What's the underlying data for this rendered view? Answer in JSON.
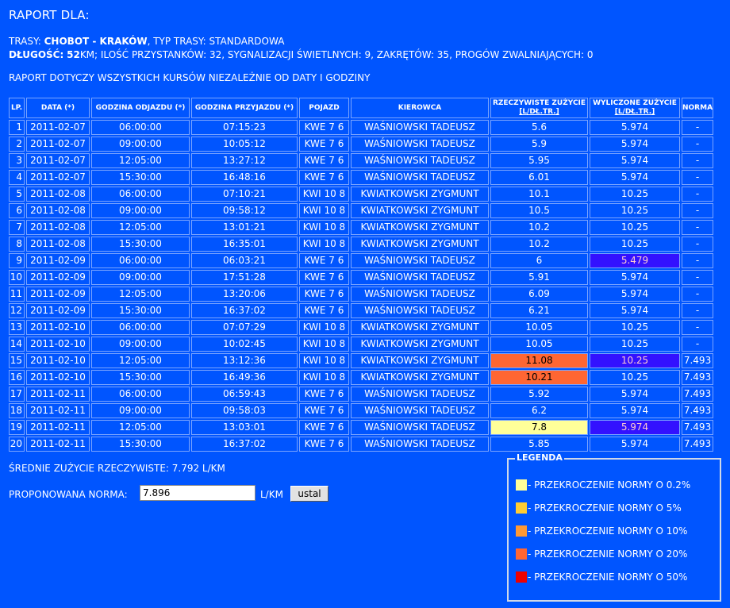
{
  "header": {
    "title": "RAPORT DLA:",
    "route_prefix": "TRASY:",
    "route_name": "CHOBOT - KRAKÓW",
    "route_type_text": ", TYP TRASY: STANDARDOWA",
    "length_label": "DŁUGOŚĆ:",
    "length_value": "52",
    "length_rest": "KM; ILOŚĆ PRZYSTANKÓW: 32, SYGNALIZACJI ŚWIETLNYCH: 9, ZAKRĘTÓW: 35, PROGÓW ZWALNIAJĄCYCH: 0",
    "scope_note": "RAPORT DOTYCZY WSZYSTKICH KURSÓW NIEZALEŻNIE OD DATY I GODZINY"
  },
  "table": {
    "columns": [
      "LP.",
      "DATA (*)",
      "GODZINA ODJAZDU (*)",
      "GODZINA PRZYJAZDU (*)",
      "POJAZD",
      "KIEROWCA",
      "RZECZYWISTE ZUŻYCIE",
      "WYLICZONE ZUŻYCIE",
      "NORMA"
    ],
    "unit_sub": "[L/DŁ.TR.]",
    "rows": [
      {
        "lp": "1",
        "date": "2011-02-07",
        "dep": "06:00:00",
        "arr": "07:15:23",
        "vehicle": "KWE 7 6",
        "driver": "WAŚNIOWSKI TADEUSZ",
        "actual": "5.6",
        "calc": "5.974",
        "norm": "-"
      },
      {
        "lp": "2",
        "date": "2011-02-07",
        "dep": "09:00:00",
        "arr": "10:05:12",
        "vehicle": "KWE 7 6",
        "driver": "WAŚNIOWSKI TADEUSZ",
        "actual": "5.9",
        "calc": "5.974",
        "norm": "-"
      },
      {
        "lp": "3",
        "date": "2011-02-07",
        "dep": "12:05:00",
        "arr": "13:27:12",
        "vehicle": "KWE 7 6",
        "driver": "WAŚNIOWSKI TADEUSZ",
        "actual": "5.95",
        "calc": "5.974",
        "norm": "-"
      },
      {
        "lp": "4",
        "date": "2011-02-07",
        "dep": "15:30:00",
        "arr": "16:48:16",
        "vehicle": "KWE 7 6",
        "driver": "WAŚNIOWSKI TADEUSZ",
        "actual": "6.01",
        "calc": "5.974",
        "norm": "-"
      },
      {
        "lp": "5",
        "date": "2011-02-08",
        "dep": "06:00:00",
        "arr": "07:10:21",
        "vehicle": "KWI 10 8",
        "driver": "KWIATKOWSKI ZYGMUNT",
        "actual": "10.1",
        "calc": "10.25",
        "norm": "-"
      },
      {
        "lp": "6",
        "date": "2011-02-08",
        "dep": "09:00:00",
        "arr": "09:58:12",
        "vehicle": "KWI 10 8",
        "driver": "KWIATKOWSKI ZYGMUNT",
        "actual": "10.5",
        "calc": "10.25",
        "norm": "-"
      },
      {
        "lp": "7",
        "date": "2011-02-08",
        "dep": "12:05:00",
        "arr": "13:01:21",
        "vehicle": "KWI 10 8",
        "driver": "KWIATKOWSKI ZYGMUNT",
        "actual": "10.2",
        "calc": "10.25",
        "norm": "-"
      },
      {
        "lp": "8",
        "date": "2011-02-08",
        "dep": "15:30:00",
        "arr": "16:35:01",
        "vehicle": "KWI 10 8",
        "driver": "KWIATKOWSKI ZYGMUNT",
        "actual": "10.2",
        "calc": "10.25",
        "norm": "-"
      },
      {
        "lp": "9",
        "date": "2011-02-09",
        "dep": "06:00:00",
        "arr": "06:03:21",
        "vehicle": "KWE 7 6",
        "driver": "WAŚNIOWSKI TADEUSZ",
        "actual": "6",
        "calc": "5.479",
        "norm": "-",
        "calc_highlight": "purple"
      },
      {
        "lp": "10",
        "date": "2011-02-09",
        "dep": "09:00:00",
        "arr": "17:51:28",
        "vehicle": "KWE 7 6",
        "driver": "WAŚNIOWSKI TADEUSZ",
        "actual": "5.91",
        "calc": "5.974",
        "norm": "-"
      },
      {
        "lp": "11",
        "date": "2011-02-09",
        "dep": "12:05:00",
        "arr": "13:20:06",
        "vehicle": "KWE 7 6",
        "driver": "WAŚNIOWSKI TADEUSZ",
        "actual": "6.09",
        "calc": "5.974",
        "norm": "-"
      },
      {
        "lp": "12",
        "date": "2011-02-09",
        "dep": "15:30:00",
        "arr": "16:37:02",
        "vehicle": "KWE 7 6",
        "driver": "WAŚNIOWSKI TADEUSZ",
        "actual": "6.21",
        "calc": "5.974",
        "norm": "-"
      },
      {
        "lp": "13",
        "date": "2011-02-10",
        "dep": "06:00:00",
        "arr": "07:07:29",
        "vehicle": "KWI 10 8",
        "driver": "KWIATKOWSKI ZYGMUNT",
        "actual": "10.05",
        "calc": "10.25",
        "norm": "-"
      },
      {
        "lp": "14",
        "date": "2011-02-10",
        "dep": "09:00:00",
        "arr": "10:02:45",
        "vehicle": "KWI 10 8",
        "driver": "KWIATKOWSKI ZYGMUNT",
        "actual": "10.05",
        "calc": "10.25",
        "norm": "-"
      },
      {
        "lp": "15",
        "date": "2011-02-10",
        "dep": "12:05:00",
        "arr": "13:12:36",
        "vehicle": "KWI 10 8",
        "driver": "KWIATKOWSKI ZYGMUNT",
        "actual": "11.08",
        "calc": "10.25",
        "norm": "7.493",
        "actual_highlight": "orange",
        "calc_highlight": "purple"
      },
      {
        "lp": "16",
        "date": "2011-02-10",
        "dep": "15:30:00",
        "arr": "16:49:36",
        "vehicle": "KWI 10 8",
        "driver": "KWIATKOWSKI ZYGMUNT",
        "actual": "10.21",
        "calc": "10.25",
        "norm": "7.493",
        "actual_highlight": "orange"
      },
      {
        "lp": "17",
        "date": "2011-02-11",
        "dep": "06:00:00",
        "arr": "06:59:43",
        "vehicle": "KWE 7 6",
        "driver": "WAŚNIOWSKI TADEUSZ",
        "actual": "5.92",
        "calc": "5.974",
        "norm": "7.493"
      },
      {
        "lp": "18",
        "date": "2011-02-11",
        "dep": "09:00:00",
        "arr": "09:58:03",
        "vehicle": "KWE 7 6",
        "driver": "WAŚNIOWSKI TADEUSZ",
        "actual": "6.2",
        "calc": "5.974",
        "norm": "7.493"
      },
      {
        "lp": "19",
        "date": "2011-02-11",
        "dep": "12:05:00",
        "arr": "13:03:01",
        "vehicle": "KWE 7 6",
        "driver": "WAŚNIOWSKI TADEUSZ",
        "actual": "7.8",
        "calc": "5.974",
        "norm": "7.493",
        "actual_highlight": "yellow",
        "calc_highlight": "purple"
      },
      {
        "lp": "20",
        "date": "2011-02-11",
        "dep": "15:30:00",
        "arr": "16:37:02",
        "vehicle": "KWE 7 6",
        "driver": "WAŚNIOWSKI TADEUSZ",
        "actual": "5.85",
        "calc": "5.974",
        "norm": "7.493"
      }
    ]
  },
  "summary": {
    "average_text": "ŚREDNIE ZUŻYCIE RZECZYWISTE: 7.792 L/KM",
    "proposed_label": "PROPONOWANA NORMA:",
    "proposed_value": "7.896",
    "proposed_unit": "L/KM",
    "set_button": "ustal"
  },
  "legend": {
    "title": "LEGENDA",
    "items": [
      {
        "color": "#ffff99",
        "label": "- PRZEKROCZENIE NORMY O 0.2%"
      },
      {
        "color": "#ffcc33",
        "label": "- PRZEKROCZENIE NORMY O 5%"
      },
      {
        "color": "#ff9933",
        "label": "- PRZEKROCZENIE NORMY O 10%"
      },
      {
        "color": "#ff6633",
        "label": "- PRZEKROCZENIE NORMY O 20%"
      },
      {
        "color": "#ee0000",
        "label": "- PRZEKROCZENIE NORMY O 50%"
      }
    ]
  }
}
